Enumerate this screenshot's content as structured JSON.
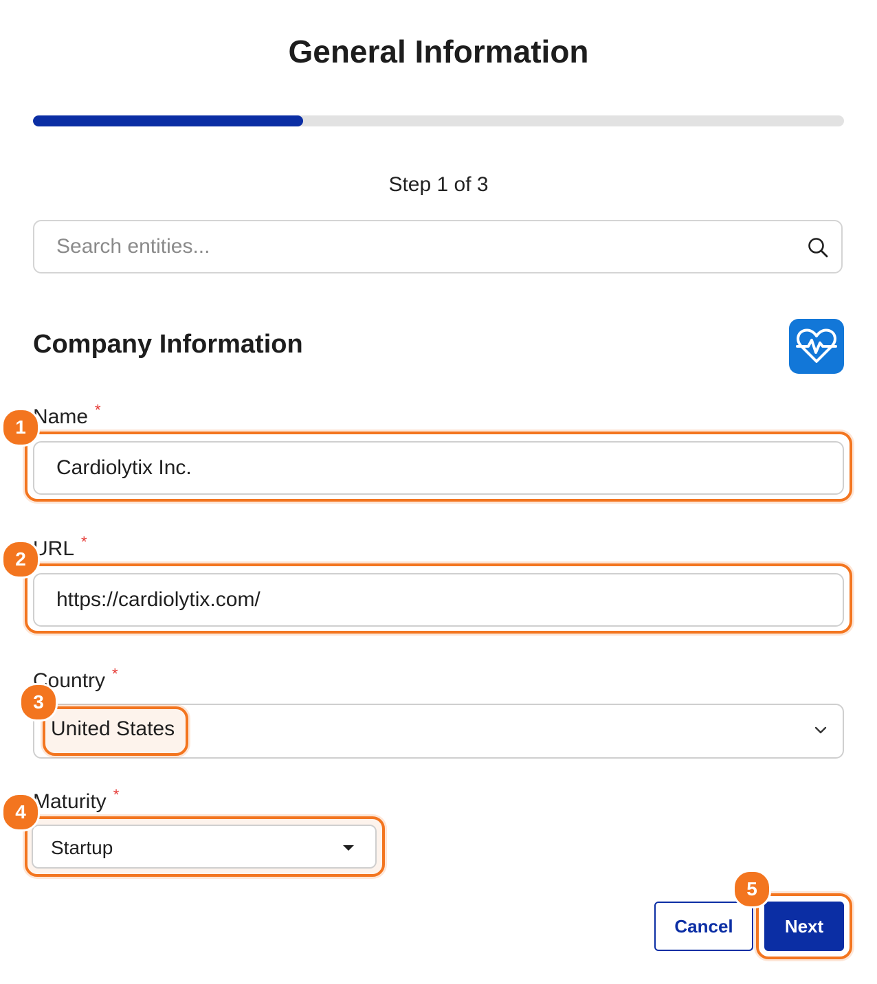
{
  "header": {
    "title": "General Information"
  },
  "progress": {
    "fraction": 0.333,
    "step_text": "Step 1 of 3"
  },
  "search": {
    "placeholder": "Search entities..."
  },
  "section": {
    "title": "Company Information",
    "badge_icon": "heart-pulse-icon",
    "badge_color": "#1277d8"
  },
  "form": {
    "name": {
      "label": "Name",
      "required_mark": "*",
      "value": "Cardiolytix Inc."
    },
    "url": {
      "label": "URL",
      "required_mark": "*",
      "value": "https://cardiolytix.com/"
    },
    "country": {
      "label": "Country",
      "required_mark": "*",
      "value": "United States"
    },
    "maturity": {
      "label": "Maturity",
      "required_mark": "*",
      "value": "Startup"
    }
  },
  "actions": {
    "cancel_label": "Cancel",
    "next_label": "Next"
  },
  "annotations": {
    "markers": [
      "1",
      "2",
      "3",
      "4",
      "5"
    ],
    "color": "#f3751f"
  },
  "colors": {
    "primary": "#0b2ea4",
    "required": "#e53935"
  }
}
